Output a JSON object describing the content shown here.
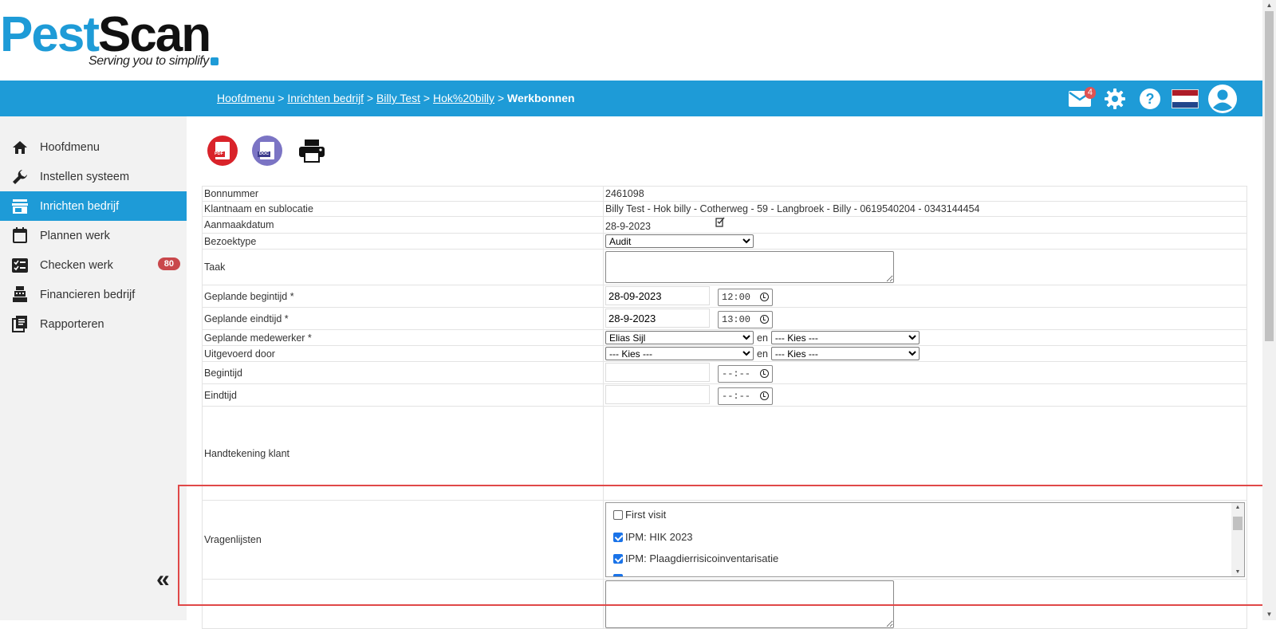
{
  "logo": {
    "word_part1": "Pest",
    "word_part2": "Scan",
    "tagline": "Serving you to simplify"
  },
  "breadcrumb": {
    "links": [
      "Hoofdmenu",
      "Inrichten bedrijf",
      "Billy Test",
      "Hok%20billy"
    ],
    "separator": ">",
    "current": "Werkbonnen"
  },
  "header": {
    "mail_badge": "4",
    "icons": [
      "mail-icon",
      "gear-icon",
      "help-icon",
      "flag-nl-icon",
      "user-icon"
    ],
    "flag_colors": [
      "#ae1c28",
      "#ffffff",
      "#21468b"
    ]
  },
  "sidebar": {
    "items": [
      {
        "label": "Hoofdmenu",
        "icon": "home-icon"
      },
      {
        "label": "Instellen systeem",
        "icon": "wrench-icon"
      },
      {
        "label": "Inrichten bedrijf",
        "icon": "store-icon",
        "active": true
      },
      {
        "label": "Plannen werk",
        "icon": "calendar-icon"
      },
      {
        "label": "Checken werk",
        "icon": "checklist-icon",
        "badge": "80"
      },
      {
        "label": "Financieren bedrijf",
        "icon": "cash-register-icon"
      },
      {
        "label": "Rapporteren",
        "icon": "report-icon"
      }
    ],
    "collapse_glyph": "«"
  },
  "toolbar": {
    "pdf_label": "PDF",
    "doc_label": "DOC"
  },
  "form": {
    "bonnummer": {
      "label": "Bonnummer",
      "value": "2461098"
    },
    "klant": {
      "label": "Klantnaam en sublocatie",
      "value": "Billy Test - Hok billy - Cotherweg - 59 - Langbroek - Billy - 0619540204 - 0343144454"
    },
    "aanmaakdatum": {
      "label": "Aanmaakdatum",
      "value": "28-9-2023"
    },
    "bezoektype": {
      "label": "Bezoektype",
      "value": "Audit"
    },
    "taak": {
      "label": "Taak",
      "value": ""
    },
    "begintijd_gepland": {
      "label": "Geplande begintijd *",
      "date": "28-09-2023",
      "time": "12:00"
    },
    "eindtijd_gepland": {
      "label": "Geplande eindtijd *",
      "date": "28-9-2023",
      "time": "13:00"
    },
    "medewerker": {
      "label": "Geplande medewerker *",
      "value1": "Elias Sijl",
      "joiner": "en",
      "value2": "--- Kies ---"
    },
    "uitgevoerd": {
      "label": "Uitgevoerd door",
      "value1": "--- Kies ---",
      "joiner": "en",
      "value2": "--- Kies ---"
    },
    "begintijd": {
      "label": "Begintijd",
      "date": "",
      "time": "--:--"
    },
    "eindtijd": {
      "label": "Eindtijd",
      "date": "",
      "time": "--:--"
    },
    "handtekening": {
      "label": "Handtekening klant"
    },
    "vragenlijsten": {
      "label": "Vragenlijsten",
      "items": [
        {
          "label": "First visit",
          "checked": false
        },
        {
          "label": "IPM: HIK 2023",
          "checked": true
        },
        {
          "label": "IPM: Plaagdierrisicoinventarisatie",
          "checked": true
        }
      ]
    }
  },
  "colors": {
    "accent": "#1e9bd7",
    "badge": "#c9474b",
    "highlight": "#e04848"
  }
}
